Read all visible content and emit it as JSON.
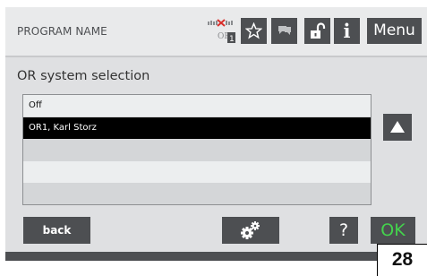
{
  "header": {
    "program_name": "PROGRAM NAME",
    "or_indicator_label": "OR",
    "or_indicator_number": "1",
    "info_label": "i",
    "menu_label": "Menu"
  },
  "screen": {
    "title": "OR system selection"
  },
  "list": {
    "items": [
      {
        "label": "Off",
        "selected": false
      },
      {
        "label": "OR1, Karl Storz",
        "selected": true
      },
      {
        "label": "",
        "selected": false
      },
      {
        "label": "",
        "selected": false
      },
      {
        "label": "",
        "selected": false
      }
    ]
  },
  "footer": {
    "back_label": "back",
    "help_label": "?",
    "ok_label": "OK"
  },
  "page_number": "28",
  "colors": {
    "button_bg": "#4d4f52",
    "ok_text": "#44d24d",
    "selected_row": "#000000",
    "indicator_red": "#d9302c"
  },
  "icons": [
    "or-connection-icon",
    "star-icon",
    "chat-icon",
    "unlock-icon",
    "info-icon",
    "scroll-up-icon",
    "settings-icon"
  ]
}
